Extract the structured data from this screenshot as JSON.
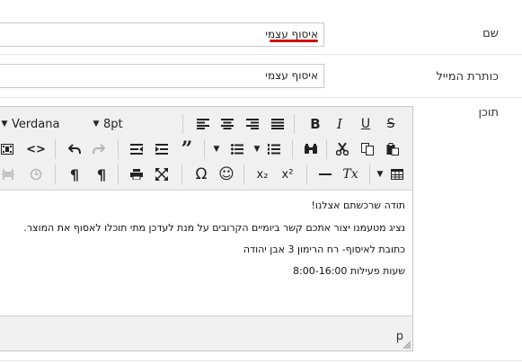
{
  "form": {
    "name": {
      "label": "שם",
      "value": "איסוף עצמי"
    },
    "email": {
      "label": "כותרת המייל",
      "value": "איסוף עצמי"
    },
    "content": {
      "label": "תוכן"
    }
  },
  "toolbar": {
    "font_family": "Verdana",
    "font_size": "8pt",
    "bold": "B",
    "italic": "I",
    "underline": "U",
    "strike": "S",
    "quote": "”",
    "omega": "Ω",
    "smiley": "☺",
    "subscript": "x₂",
    "superscript": "x²",
    "clear_format": "Tx",
    "code": "<>"
  },
  "editor": {
    "lines": [
      "תודה שרכשתם אצלנו!",
      "נציג מטעמנו יצור אתכם קשר ביומיים הקרובים על מנת לעדכן מתי תוכלו לאסוף את המוצר.",
      "כתובת לאיסוף- רח הרימון 3 אבן יהודה",
      "שעות פעילות 8:00-16:00"
    ],
    "status_path": "p"
  },
  "colors": {
    "accent_underline": "#d01010"
  }
}
